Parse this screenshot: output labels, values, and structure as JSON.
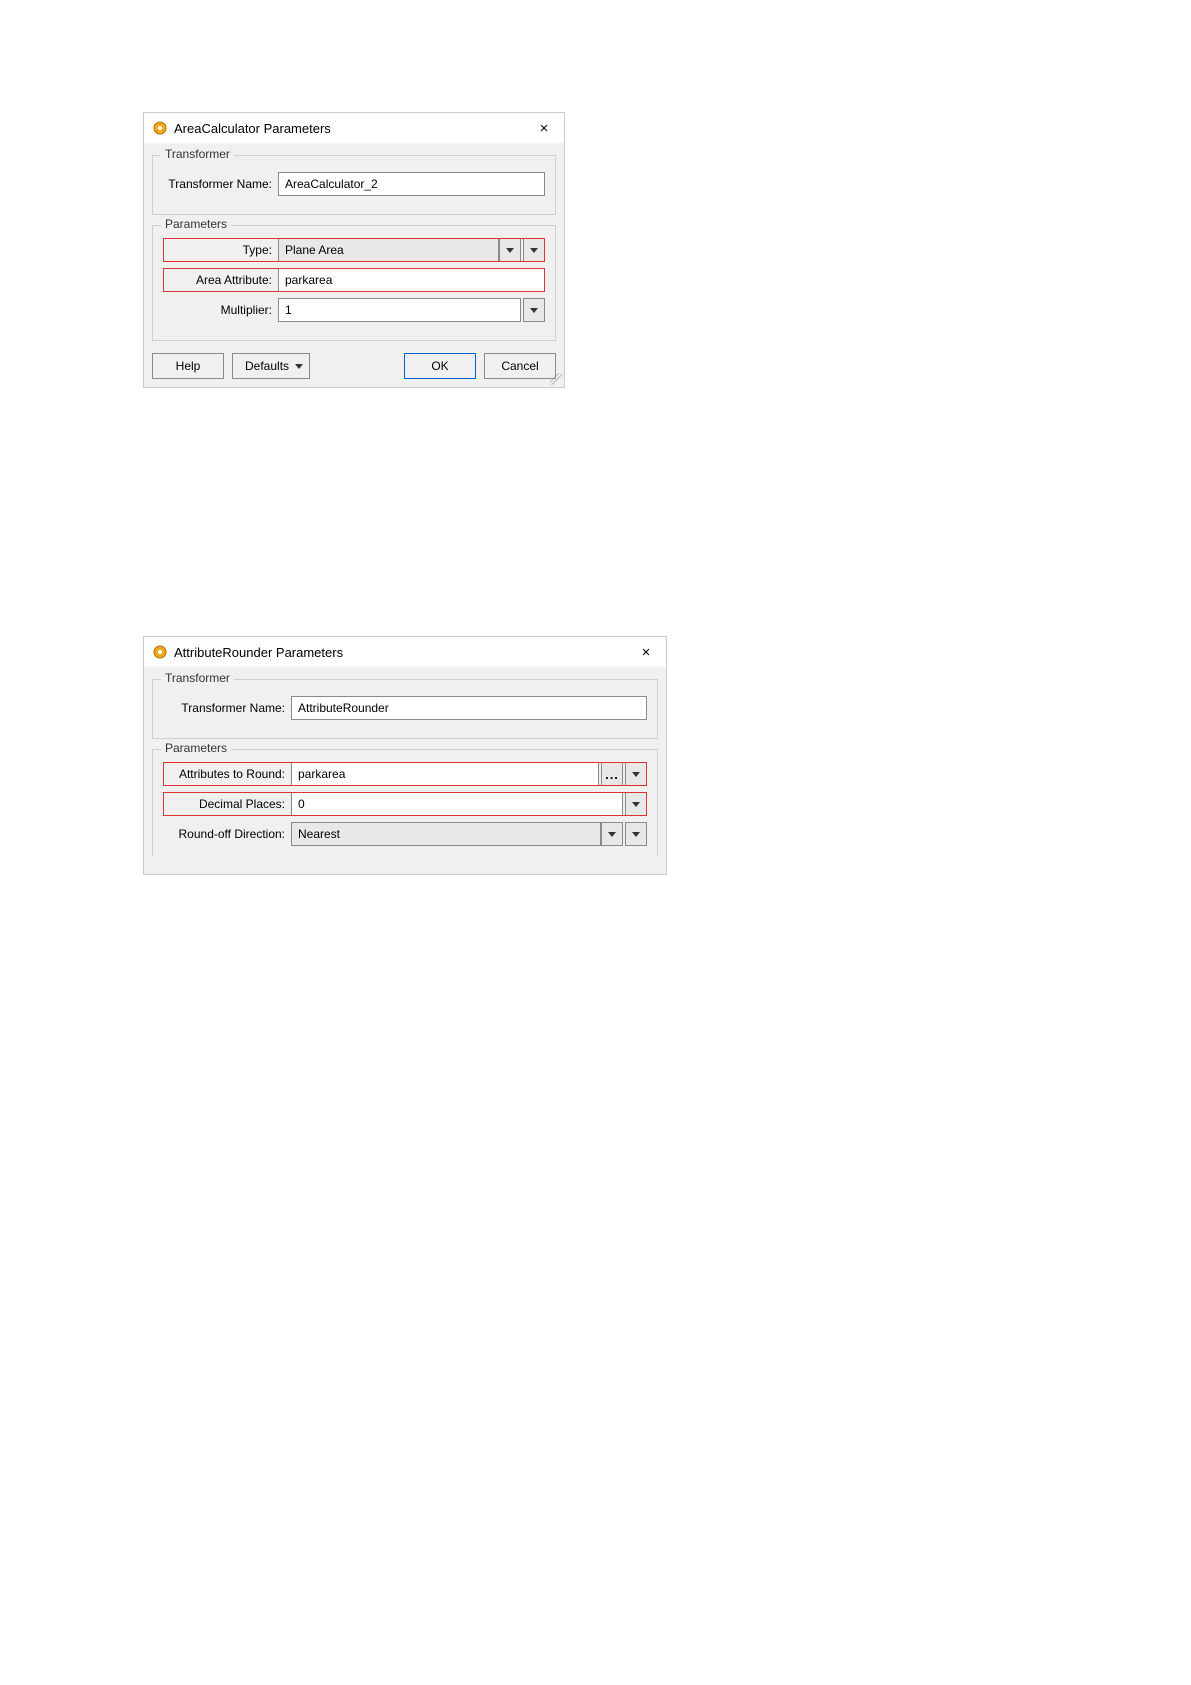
{
  "dialog1": {
    "title": "AreaCalculator Parameters",
    "icon": "fme-transformer-icon",
    "close": "×",
    "groups": {
      "transformer": {
        "legend": "Transformer",
        "nameLabel": "Transformer Name:",
        "nameValue": "AreaCalculator_2"
      },
      "parameters": {
        "legend": "Parameters",
        "typeLabel": "Type:",
        "typeValue": "Plane Area",
        "areaAttrLabel": "Area Attribute:",
        "areaAttrValue": "parkarea",
        "multiplierLabel": "Multiplier:",
        "multiplierValue": "1"
      }
    },
    "buttons": {
      "help": "Help",
      "defaults": "Defaults",
      "ok": "OK",
      "cancel": "Cancel"
    }
  },
  "dialog2": {
    "title": "AttributeRounder Parameters",
    "icon": "fme-transformer-icon",
    "close": "×",
    "groups": {
      "transformer": {
        "legend": "Transformer",
        "nameLabel": "Transformer Name:",
        "nameValue": "AttributeRounder"
      },
      "parameters": {
        "legend": "Parameters",
        "attrsLabel": "Attributes to Round:",
        "attrsValue": "parkarea",
        "decLabel": "Decimal Places:",
        "decValue": "0",
        "roDirLabel": "Round-off Direction:",
        "roDirValue": "Nearest"
      }
    }
  },
  "icons": {
    "dots": "..."
  }
}
